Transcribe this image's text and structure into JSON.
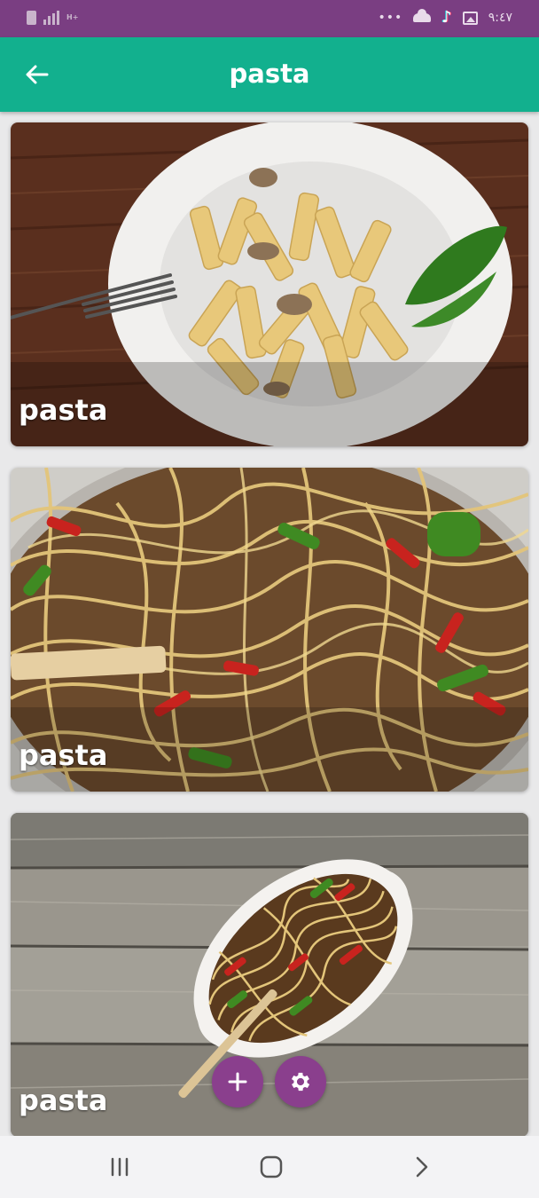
{
  "status_bar": {
    "time": "٩:٤٧",
    "network_label": "H+",
    "icons": [
      "sim-icon",
      "signal-icon",
      "more-dots-icon",
      "cloud-icon",
      "tiktok-icon",
      "image-icon"
    ]
  },
  "app_bar": {
    "title": "pasta",
    "back_icon": "arrow-left-icon",
    "color": "#12b08e"
  },
  "cards": [
    {
      "label": "pasta",
      "image": "penne pasta dish"
    },
    {
      "label": "pasta",
      "image": "stir-fried noodles"
    },
    {
      "label": "pasta",
      "image": "noodles in oval dish"
    }
  ],
  "fabs": {
    "add_icon": "plus-icon",
    "settings_icon": "gear-icon",
    "color": "#8a3f8d"
  },
  "nav_bar": {
    "icons": [
      "recent-apps-icon",
      "home-icon",
      "back-chevron-icon"
    ]
  },
  "colors": {
    "status_bar": "#7a3e82",
    "background": "#e9e9ea"
  }
}
